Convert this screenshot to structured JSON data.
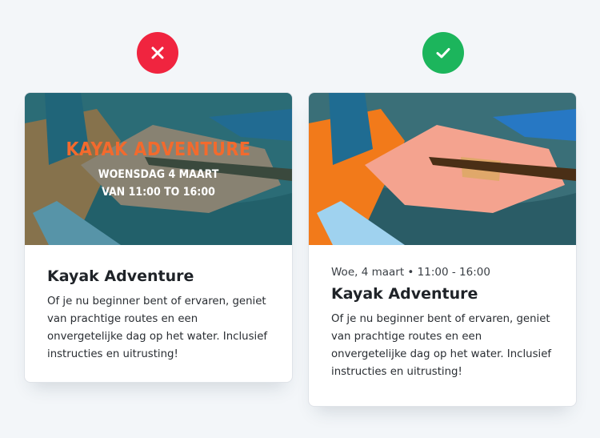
{
  "bad_example": {
    "badge_icon": "close-icon",
    "badge_color": "#f0243f",
    "overlay": {
      "title": "KAYAK ADVENTURE",
      "date": "WOENSDAG 4 MAART",
      "time": "VAN 11:00 TO 16:00"
    },
    "title": "Kayak Adventure",
    "description": "Of je nu beginner bent of ervaren, geniet van prachtige routes en een onvergetelijke dag op het water. Inclusief instructies en uitrusting!"
  },
  "good_example": {
    "badge_icon": "checkmark-icon",
    "badge_color": "#1cb55c",
    "meta": "Woe, 4 maart  •  11:00 - 16:00",
    "title": "Kayak Adventure",
    "description": "Of je nu beginner bent of ervaren, geniet van prachtige routes en een onvergetelijke dag op het water. Inclusief instructies en uitrusting!"
  }
}
